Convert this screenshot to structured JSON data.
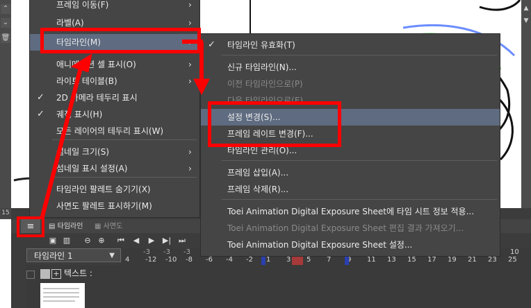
{
  "left_menu": {
    "items": [
      {
        "label": "프레임 이동(F)",
        "check": false,
        "submenu": true
      },
      {
        "label": "라벨(A)",
        "check": false,
        "submenu": true
      },
      {
        "label": "타임라인(M)",
        "check": false,
        "submenu": true,
        "highlight": true
      },
      {
        "label": "애니메이션 셀 표시(O)",
        "check": false,
        "submenu": true
      },
      {
        "label": "라이트 테이블(B)",
        "check": false,
        "submenu": true
      },
      {
        "label": "2D 카메라 테두리 표시",
        "check": true,
        "submenu": false
      },
      {
        "label": "궤적 표시(H)",
        "check": true,
        "submenu": false
      },
      {
        "label": "모든 레이어의 테두리 표시(W)",
        "check": false,
        "submenu": false
      },
      {
        "label": "섬네일 크기(S)",
        "check": false,
        "submenu": true
      },
      {
        "label": "섬네일 표시 설정(A)",
        "check": false,
        "submenu": true
      },
      {
        "label": "타임라인 팔레트 숨기기(X)",
        "check": false,
        "submenu": false
      },
      {
        "label": "사면도 팔레트 표시하기(M)",
        "check": false,
        "submenu": false
      }
    ]
  },
  "right_menu": {
    "items": [
      {
        "label": "타임라인 유효화(T)",
        "check": true,
        "disabled": false
      },
      {
        "label": "신규 타임라인(N)...",
        "check": false,
        "disabled": false
      },
      {
        "label": "이전 타임라인으로(P)",
        "check": false,
        "disabled": true
      },
      {
        "label": "다음 타임라인으로(E)",
        "check": false,
        "disabled": true
      },
      {
        "label": "설정 변경(S)...",
        "check": false,
        "disabled": false,
        "highlight": true
      },
      {
        "label": "프레임 레이트 변경(F)...",
        "check": false,
        "disabled": false
      },
      {
        "label": "타임라인 관리(O)...",
        "check": false,
        "disabled": false
      },
      {
        "label": "프레임 삽입(A)...",
        "check": false,
        "disabled": false
      },
      {
        "label": "프레임 삭제(R)...",
        "check": false,
        "disabled": false
      },
      {
        "label": "Toei Animation Digital Exposure Sheet에 타임 시트 정보 적용...",
        "check": false,
        "disabled": false
      },
      {
        "label": "Toei Animation Digital Exposure Sheet 편집 결과 가져오기...",
        "check": false,
        "disabled": true
      },
      {
        "label": "Toei Animation Digital Exposure Sheet 설정...",
        "check": false,
        "disabled": false
      }
    ]
  },
  "timeline": {
    "tab_label": "타임라인",
    "tab2_label": "사면도",
    "select_value": "타임라인 1",
    "track_label": "텍스트 :",
    "ruler_top": [
      "-3",
      "-3",
      "-3",
      "-3",
      "-3"
    ],
    "ruler_bottom": [
      "4",
      "-12",
      "-10",
      "-8",
      "-6",
      "-4",
      "-2",
      "1",
      "3",
      "5",
      "7",
      "9",
      "11",
      "13",
      "15",
      "17",
      "19",
      "21",
      "23",
      "25"
    ],
    "ruler_top_right": [
      "5",
      "10"
    ]
  },
  "left_strip": {
    "sb_label": "15"
  },
  "colors": {
    "menu_bg": "#454545",
    "highlight": "#5e6b80",
    "annotation": "#ff0000"
  }
}
